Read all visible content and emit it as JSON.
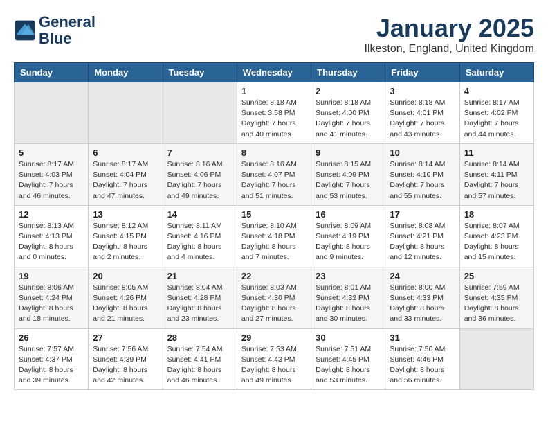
{
  "header": {
    "logo_line1": "General",
    "logo_line2": "Blue",
    "title": "January 2025",
    "subtitle": "Ilkeston, England, United Kingdom"
  },
  "days_of_week": [
    "Sunday",
    "Monday",
    "Tuesday",
    "Wednesday",
    "Thursday",
    "Friday",
    "Saturday"
  ],
  "weeks": [
    [
      {
        "day": "",
        "sunrise": "",
        "sunset": "",
        "daylight": ""
      },
      {
        "day": "",
        "sunrise": "",
        "sunset": "",
        "daylight": ""
      },
      {
        "day": "",
        "sunrise": "",
        "sunset": "",
        "daylight": ""
      },
      {
        "day": "1",
        "sunrise": "Sunrise: 8:18 AM",
        "sunset": "Sunset: 3:58 PM",
        "daylight": "Daylight: 7 hours and 40 minutes."
      },
      {
        "day": "2",
        "sunrise": "Sunrise: 8:18 AM",
        "sunset": "Sunset: 4:00 PM",
        "daylight": "Daylight: 7 hours and 41 minutes."
      },
      {
        "day": "3",
        "sunrise": "Sunrise: 8:18 AM",
        "sunset": "Sunset: 4:01 PM",
        "daylight": "Daylight: 7 hours and 43 minutes."
      },
      {
        "day": "4",
        "sunrise": "Sunrise: 8:17 AM",
        "sunset": "Sunset: 4:02 PM",
        "daylight": "Daylight: 7 hours and 44 minutes."
      }
    ],
    [
      {
        "day": "5",
        "sunrise": "Sunrise: 8:17 AM",
        "sunset": "Sunset: 4:03 PM",
        "daylight": "Daylight: 7 hours and 46 minutes."
      },
      {
        "day": "6",
        "sunrise": "Sunrise: 8:17 AM",
        "sunset": "Sunset: 4:04 PM",
        "daylight": "Daylight: 7 hours and 47 minutes."
      },
      {
        "day": "7",
        "sunrise": "Sunrise: 8:16 AM",
        "sunset": "Sunset: 4:06 PM",
        "daylight": "Daylight: 7 hours and 49 minutes."
      },
      {
        "day": "8",
        "sunrise": "Sunrise: 8:16 AM",
        "sunset": "Sunset: 4:07 PM",
        "daylight": "Daylight: 7 hours and 51 minutes."
      },
      {
        "day": "9",
        "sunrise": "Sunrise: 8:15 AM",
        "sunset": "Sunset: 4:09 PM",
        "daylight": "Daylight: 7 hours and 53 minutes."
      },
      {
        "day": "10",
        "sunrise": "Sunrise: 8:14 AM",
        "sunset": "Sunset: 4:10 PM",
        "daylight": "Daylight: 7 hours and 55 minutes."
      },
      {
        "day": "11",
        "sunrise": "Sunrise: 8:14 AM",
        "sunset": "Sunset: 4:11 PM",
        "daylight": "Daylight: 7 hours and 57 minutes."
      }
    ],
    [
      {
        "day": "12",
        "sunrise": "Sunrise: 8:13 AM",
        "sunset": "Sunset: 4:13 PM",
        "daylight": "Daylight: 8 hours and 0 minutes."
      },
      {
        "day": "13",
        "sunrise": "Sunrise: 8:12 AM",
        "sunset": "Sunset: 4:15 PM",
        "daylight": "Daylight: 8 hours and 2 minutes."
      },
      {
        "day": "14",
        "sunrise": "Sunrise: 8:11 AM",
        "sunset": "Sunset: 4:16 PM",
        "daylight": "Daylight: 8 hours and 4 minutes."
      },
      {
        "day": "15",
        "sunrise": "Sunrise: 8:10 AM",
        "sunset": "Sunset: 4:18 PM",
        "daylight": "Daylight: 8 hours and 7 minutes."
      },
      {
        "day": "16",
        "sunrise": "Sunrise: 8:09 AM",
        "sunset": "Sunset: 4:19 PM",
        "daylight": "Daylight: 8 hours and 9 minutes."
      },
      {
        "day": "17",
        "sunrise": "Sunrise: 8:08 AM",
        "sunset": "Sunset: 4:21 PM",
        "daylight": "Daylight: 8 hours and 12 minutes."
      },
      {
        "day": "18",
        "sunrise": "Sunrise: 8:07 AM",
        "sunset": "Sunset: 4:23 PM",
        "daylight": "Daylight: 8 hours and 15 minutes."
      }
    ],
    [
      {
        "day": "19",
        "sunrise": "Sunrise: 8:06 AM",
        "sunset": "Sunset: 4:24 PM",
        "daylight": "Daylight: 8 hours and 18 minutes."
      },
      {
        "day": "20",
        "sunrise": "Sunrise: 8:05 AM",
        "sunset": "Sunset: 4:26 PM",
        "daylight": "Daylight: 8 hours and 21 minutes."
      },
      {
        "day": "21",
        "sunrise": "Sunrise: 8:04 AM",
        "sunset": "Sunset: 4:28 PM",
        "daylight": "Daylight: 8 hours and 23 minutes."
      },
      {
        "day": "22",
        "sunrise": "Sunrise: 8:03 AM",
        "sunset": "Sunset: 4:30 PM",
        "daylight": "Daylight: 8 hours and 27 minutes."
      },
      {
        "day": "23",
        "sunrise": "Sunrise: 8:01 AM",
        "sunset": "Sunset: 4:32 PM",
        "daylight": "Daylight: 8 hours and 30 minutes."
      },
      {
        "day": "24",
        "sunrise": "Sunrise: 8:00 AM",
        "sunset": "Sunset: 4:33 PM",
        "daylight": "Daylight: 8 hours and 33 minutes."
      },
      {
        "day": "25",
        "sunrise": "Sunrise: 7:59 AM",
        "sunset": "Sunset: 4:35 PM",
        "daylight": "Daylight: 8 hours and 36 minutes."
      }
    ],
    [
      {
        "day": "26",
        "sunrise": "Sunrise: 7:57 AM",
        "sunset": "Sunset: 4:37 PM",
        "daylight": "Daylight: 8 hours and 39 minutes."
      },
      {
        "day": "27",
        "sunrise": "Sunrise: 7:56 AM",
        "sunset": "Sunset: 4:39 PM",
        "daylight": "Daylight: 8 hours and 42 minutes."
      },
      {
        "day": "28",
        "sunrise": "Sunrise: 7:54 AM",
        "sunset": "Sunset: 4:41 PM",
        "daylight": "Daylight: 8 hours and 46 minutes."
      },
      {
        "day": "29",
        "sunrise": "Sunrise: 7:53 AM",
        "sunset": "Sunset: 4:43 PM",
        "daylight": "Daylight: 8 hours and 49 minutes."
      },
      {
        "day": "30",
        "sunrise": "Sunrise: 7:51 AM",
        "sunset": "Sunset: 4:45 PM",
        "daylight": "Daylight: 8 hours and 53 minutes."
      },
      {
        "day": "31",
        "sunrise": "Sunrise: 7:50 AM",
        "sunset": "Sunset: 4:46 PM",
        "daylight": "Daylight: 8 hours and 56 minutes."
      },
      {
        "day": "",
        "sunrise": "",
        "sunset": "",
        "daylight": ""
      }
    ]
  ]
}
